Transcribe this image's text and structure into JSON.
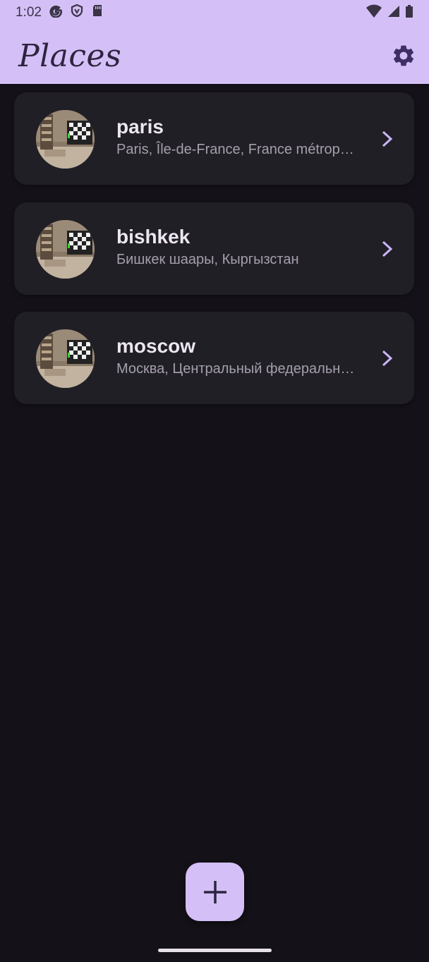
{
  "status_bar": {
    "time": "1:02",
    "left_icons": [
      "google-g-icon",
      "shield-icon",
      "sd-card-icon"
    ],
    "right_icons": [
      "wifi-icon",
      "signal-icon",
      "battery-icon"
    ]
  },
  "app_bar": {
    "title": "Places",
    "settings_icon": "gear-icon"
  },
  "places": [
    {
      "name": "paris",
      "address": "Paris, Île-de-France, France métropolitaine"
    },
    {
      "name": "bishkek",
      "address": "Бишкек шаары, Кыргызстан"
    },
    {
      "name": "moscow",
      "address": "Москва, Центральный федеральный округ"
    }
  ],
  "fab": {
    "icon": "plus-icon"
  },
  "colors": {
    "accent": "#d4c0f7",
    "background": "#141218",
    "card": "#211f26",
    "chevron": "#cbb6f5"
  }
}
